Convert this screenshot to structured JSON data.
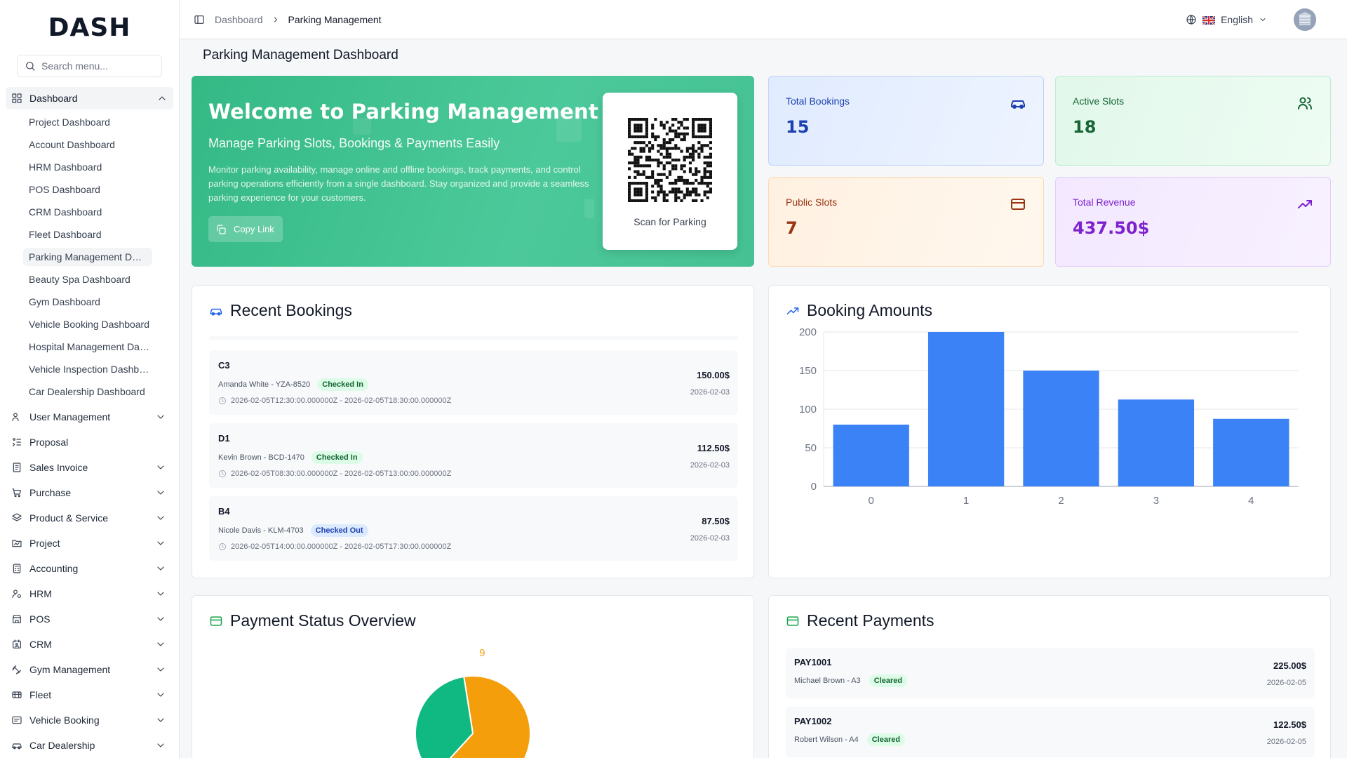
{
  "brand": {
    "logo_text": "DASH"
  },
  "sidebar": {
    "search_placeholder": "Search menu...",
    "dashboard": {
      "label": "Dashboard",
      "items": [
        "Project Dashboard",
        "Account Dashboard",
        "HRM Dashboard",
        "POS Dashboard",
        "CRM Dashboard",
        "Fleet Dashboard",
        "Parking Management Dashboard",
        "Beauty Spa Dashboard",
        "Gym Dashboard",
        "Vehicle Booking Dashboard",
        "Hospital Management Dashboard",
        "Vehicle Inspection Dashboard",
        "Car Dealership Dashboard"
      ],
      "active_index": 6
    },
    "items": [
      {
        "label": "User Management",
        "icon": "users-icon",
        "has_children": true
      },
      {
        "label": "Proposal",
        "icon": "proposal-icon",
        "has_children": false
      },
      {
        "label": "Sales Invoice",
        "icon": "invoice-icon",
        "has_children": true
      },
      {
        "label": "Purchase",
        "icon": "cart-icon",
        "has_children": true
      },
      {
        "label": "Product & Service",
        "icon": "layers-icon",
        "has_children": true
      },
      {
        "label": "Project",
        "icon": "folder-icon",
        "has_children": true
      },
      {
        "label": "Accounting",
        "icon": "calculator-icon",
        "has_children": true
      },
      {
        "label": "HRM",
        "icon": "hrm-icon",
        "has_children": true
      },
      {
        "label": "POS",
        "icon": "store-icon",
        "has_children": true
      },
      {
        "label": "CRM",
        "icon": "crm-icon",
        "has_children": true
      },
      {
        "label": "Gym Management",
        "icon": "dumbbell-icon",
        "has_children": true
      },
      {
        "label": "Fleet",
        "icon": "fleet-icon",
        "has_children": true
      },
      {
        "label": "Vehicle Booking",
        "icon": "booking-icon",
        "has_children": true
      },
      {
        "label": "Car Dealership",
        "icon": "car-icon",
        "has_children": true
      }
    ]
  },
  "topbar": {
    "breadcrumb": [
      "Dashboard",
      "Parking Management"
    ],
    "language": "English"
  },
  "page": {
    "title": "Parking Management Dashboard"
  },
  "welcome": {
    "title": "Welcome to Parking Management",
    "subtitle": "Manage Parking Slots, Bookings & Payments Easily",
    "description": "Monitor parking availability, manage online and offline bookings, track payments, and control parking operations efficiently from a single dashboard. Stay organized and provide a seamless parking experience for your customers.",
    "copy_label": "Copy Link",
    "qr_label": "Scan for Parking"
  },
  "stats": [
    {
      "label": "Total Bookings",
      "value": "15",
      "icon": "car-icon",
      "color": "#1e40af"
    },
    {
      "label": "Active Slots",
      "value": "18",
      "icon": "users-icon",
      "color": "#166534"
    },
    {
      "label": "Public Slots",
      "value": "7",
      "icon": "card-icon",
      "color": "#9a3412"
    },
    {
      "label": "Total Revenue",
      "value": "437.50$",
      "icon": "trending-up-icon",
      "color": "#7e22ce"
    }
  ],
  "recent_bookings": {
    "title": "Recent Bookings",
    "rows": [
      {
        "slot": "C3",
        "customer": "Amanda White - YZA-8520",
        "status": "Checked In",
        "time": "2026-02-05T12:30:00.000000Z - 2026-02-05T18:30:00.000000Z",
        "amount": "150.00$",
        "date": "2026-02-03"
      },
      {
        "slot": "D1",
        "customer": "Kevin Brown - BCD-1470",
        "status": "Checked In",
        "time": "2026-02-05T08:30:00.000000Z - 2026-02-05T13:00:00.000000Z",
        "amount": "112.50$",
        "date": "2026-02-03"
      },
      {
        "slot": "B4",
        "customer": "Nicole Davis - KLM-4703",
        "status": "Checked Out",
        "time": "2026-02-05T14:00:00.000000Z - 2026-02-05T17:30:00.000000Z",
        "amount": "87.50$",
        "date": "2026-02-03"
      }
    ]
  },
  "booking_amounts": {
    "title": "Booking Amounts"
  },
  "payment_status": {
    "title": "Payment Status Overview",
    "pie_label": "9"
  },
  "recent_payments": {
    "title": "Recent Payments",
    "rows": [
      {
        "id": "PAY1001",
        "customer": "Michael Brown - A3",
        "status": "Cleared",
        "amount": "225.00$",
        "date": "2026-02-05"
      },
      {
        "id": "PAY1002",
        "customer": "Robert Wilson - A4",
        "status": "Cleared",
        "amount": "122.50$",
        "date": "2026-02-05"
      }
    ]
  },
  "chart_data": [
    {
      "type": "bar",
      "categories": [
        "0",
        "1",
        "2",
        "3",
        "4"
      ],
      "values": [
        80,
        200,
        150,
        112.5,
        87.5
      ],
      "title": "Booking Amounts",
      "xlabel": "",
      "ylabel": "",
      "ylim": [
        0,
        200
      ],
      "yticks": [
        0,
        50,
        100,
        150,
        200
      ],
      "grid": true,
      "color": "#3b82f6"
    },
    {
      "type": "pie",
      "labels": [
        "",
        ""
      ],
      "values": [
        9,
        5
      ],
      "data_labels": [
        "9",
        ""
      ],
      "colors": [
        "#f59e0b",
        "#10b981"
      ],
      "title": "Payment Status Overview"
    }
  ]
}
